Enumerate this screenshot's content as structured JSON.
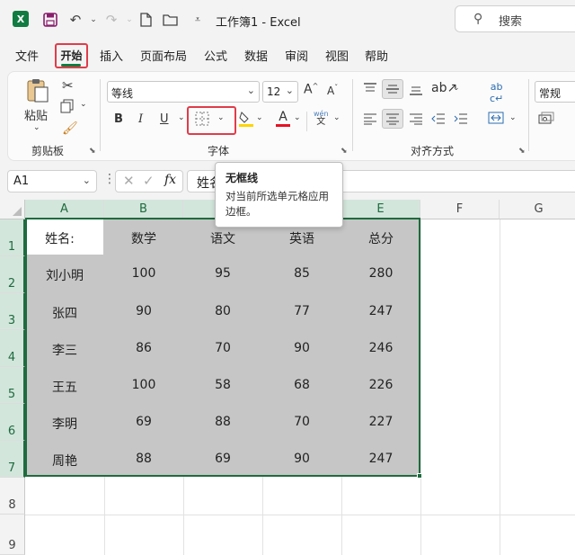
{
  "app": {
    "title": "工作簿1  -  Excel",
    "logo": "X",
    "search_placeholder": "搜索"
  },
  "tabs": [
    "文件",
    "开始",
    "插入",
    "页面布局",
    "公式",
    "数据",
    "审阅",
    "视图",
    "帮助"
  ],
  "ribbon": {
    "clipboard": {
      "paste_label": "粘贴",
      "group_label": "剪贴板"
    },
    "font": {
      "font_name": "等线",
      "font_size": "12",
      "bold": "B",
      "italic": "I",
      "underline": "U",
      "font_color_letter": "A",
      "group_label": "字体",
      "grow_font": "A",
      "shrink_font": "A",
      "phonetic_top": "wén",
      "phonetic_bottom": "文"
    },
    "alignment": {
      "group_label": "对齐方式"
    },
    "number": {
      "format": "常规"
    },
    "colors": {
      "accent": "#107c41",
      "highlight": "#e03c4a",
      "font_color_bar": "#e81123",
      "fill_color_bar": "#ffd400"
    }
  },
  "formula_bar": {
    "name_box": "A1",
    "formula_value": "姓名:",
    "fx": "fx"
  },
  "tooltip": {
    "title": "无框线",
    "description": "对当前所选单元格应用边框。"
  },
  "sheet": {
    "columns": [
      "A",
      "B",
      "C",
      "D",
      "E",
      "F",
      "G"
    ],
    "rows": [
      "1",
      "2",
      "3",
      "4",
      "5",
      "6",
      "7",
      "8",
      "9"
    ],
    "header": [
      "姓名:",
      "数学",
      "语文",
      "英语",
      "总分"
    ],
    "data": [
      [
        "刘小明",
        "100",
        "95",
        "85",
        "280"
      ],
      [
        "张四",
        "90",
        "80",
        "77",
        "247"
      ],
      [
        "李三",
        "86",
        "70",
        "90",
        "246"
      ],
      [
        "王五",
        "100",
        "58",
        "68",
        "226"
      ],
      [
        "李明",
        "69",
        "88",
        "70",
        "227"
      ],
      [
        "周艳",
        "88",
        "69",
        "90",
        "247"
      ]
    ]
  }
}
